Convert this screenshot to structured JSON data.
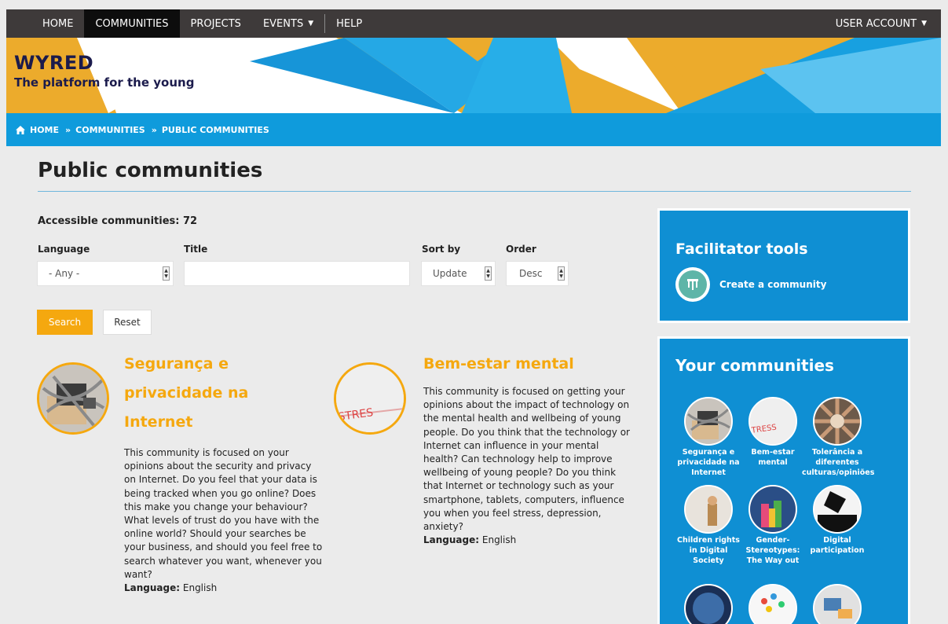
{
  "nav": {
    "items": [
      {
        "label": "HOME",
        "active": false
      },
      {
        "label": "COMMUNITIES",
        "active": true
      },
      {
        "label": "PROJECTS",
        "active": false
      },
      {
        "label": "EVENTS",
        "active": false
      },
      {
        "label": "HELP",
        "active": false
      }
    ],
    "user_account": "USER ACCOUNT"
  },
  "brand": {
    "title": "WYRED",
    "subtitle": "The platform for the young"
  },
  "breadcrumb": [
    "HOME",
    "COMMUNITIES",
    "PUBLIC COMMUNITIES"
  ],
  "page": {
    "title": "Public communities",
    "accessible_count": "Accessible communities: 72"
  },
  "filters": {
    "language_label": "Language",
    "language_value": "- Any -",
    "title_label": "Title",
    "title_value": "",
    "sortby_label": "Sort by",
    "sortby_value": "Update",
    "order_label": "Order",
    "order_value": "Desc",
    "search_label": "Search",
    "reset_label": "Reset"
  },
  "communities": [
    {
      "title": "Segurança e privacidade na Internet",
      "description": "This community is focused on your opinions about the security and privacy on Internet. Do you feel that your data is being tracked when you go online? Does this make you change your behaviour? What levels of trust do you have with the online world? Should your searches be your business, and should you feel free to search whatever you want, whenever you want?",
      "language_label": "Language:",
      "language": "English"
    },
    {
      "title": "Bem-estar mental",
      "description": "This community is focused on getting your opinions about the impact of technology on the mental health and wellbeing of young people. Do you think that the technology or Internet can influence in your mental health? Can technology help to improve wellbeing of young people? Do you think that Internet or technology such as your smartphone, tablets, computers, influence you when you feel stress, depression, anxiety?",
      "language_label": "Language:",
      "language": "English"
    }
  ],
  "sidebar": {
    "facilitator_title": "Facilitator tools",
    "create_community": "Create a community",
    "your_title": "Your communities",
    "your_communities": [
      {
        "label": "Segurança e privacidade na Internet"
      },
      {
        "label": "Bem-estar mental"
      },
      {
        "label": "Tolerância a diferentes culturas/opiniões"
      },
      {
        "label": "Children rights in Digital Society"
      },
      {
        "label": "Gender-Stereotypes: The Way out"
      },
      {
        "label": "Digital participation"
      },
      {
        "label": ""
      },
      {
        "label": ""
      },
      {
        "label": ""
      }
    ]
  },
  "colors": {
    "nav_bg": "#3e3a3a",
    "banner_orange": "#ecab2c",
    "brand_blue": "#0f9bdc",
    "accent_orange": "#f5a80f",
    "panel_blue": "#0f8fd3"
  }
}
